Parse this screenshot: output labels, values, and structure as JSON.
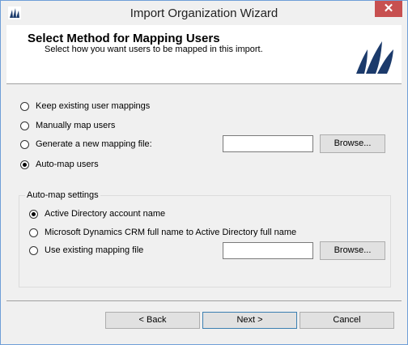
{
  "window": {
    "title": "Import Organization Wizard",
    "close_glyph": "✕"
  },
  "header": {
    "title": "Select Method for Mapping Users",
    "subtitle": "Select how you want users to be mapped in this import."
  },
  "options": {
    "keep": "Keep existing user mappings",
    "manual": "Manually map users",
    "generate": "Generate a new mapping file:",
    "automap": "Auto-map users",
    "generate_path": "",
    "browse": "Browse..."
  },
  "automap_settings": {
    "group_label": "Auto-map settings",
    "ad_account": "Active Directory account name",
    "crm_fullname": "Microsoft Dynamics CRM full name to Active Directory full name",
    "use_existing": "Use existing mapping file",
    "existing_path": "",
    "browse": "Browse..."
  },
  "selected": {
    "option": "automap",
    "automap": "ad_account"
  },
  "footer": {
    "back": "< Back",
    "next": "Next >",
    "cancel": "Cancel"
  }
}
